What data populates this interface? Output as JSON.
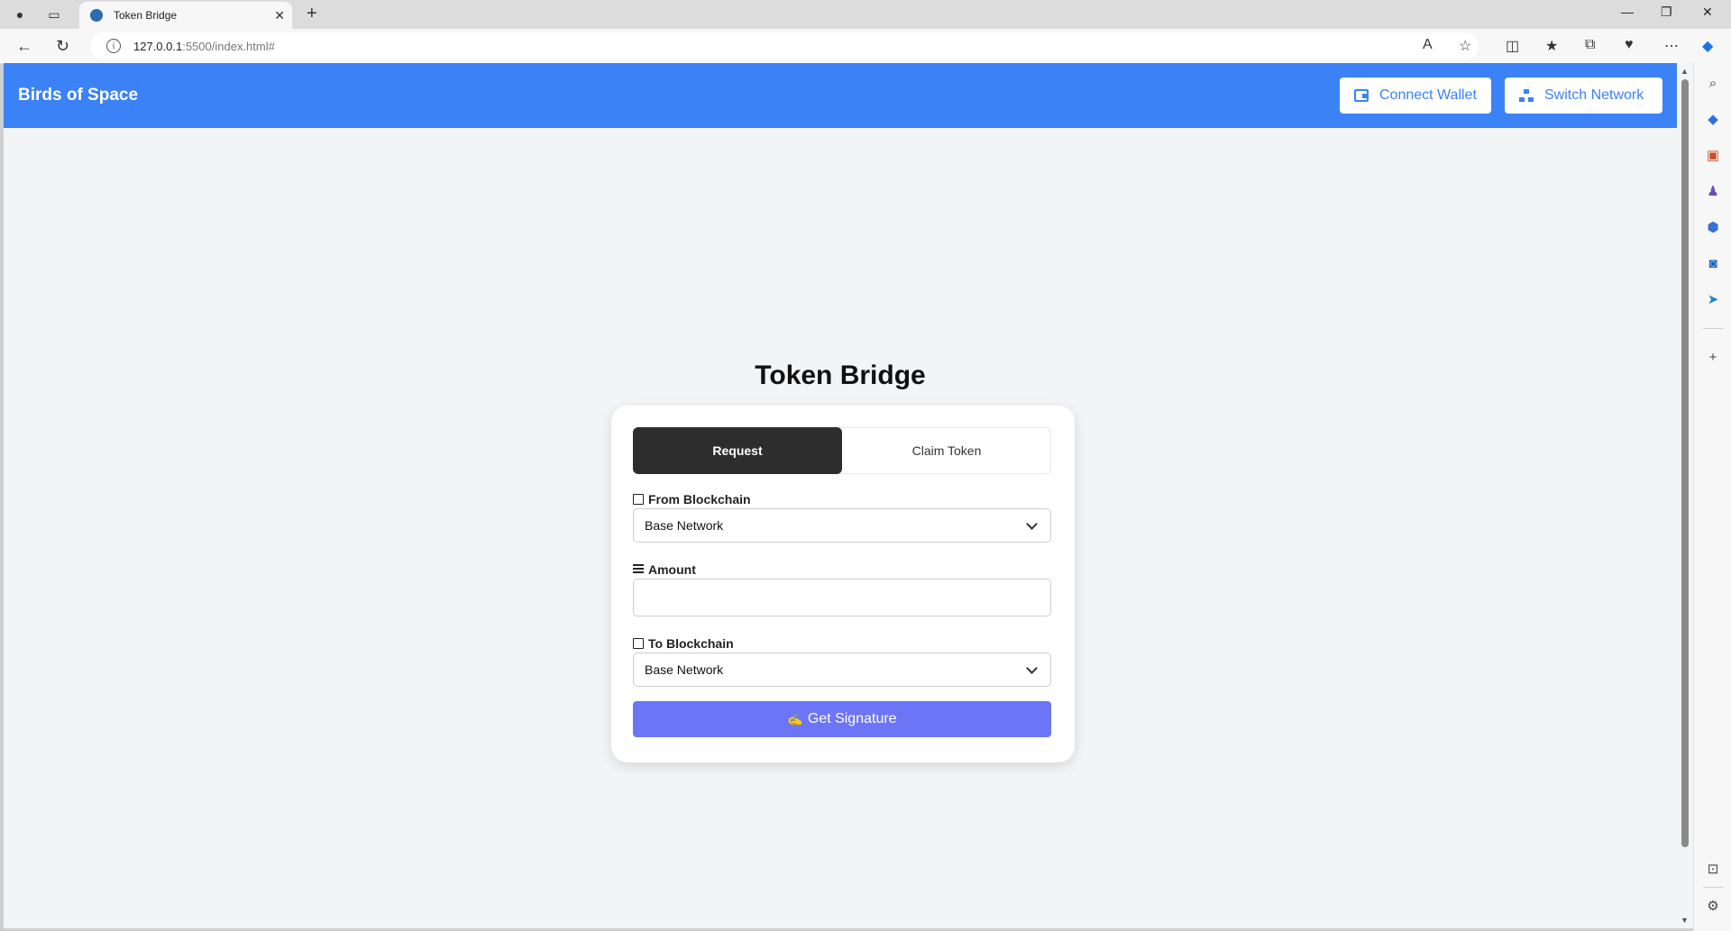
{
  "browser": {
    "tab_title": "Token Bridge",
    "url_host": "127.0.0.1",
    "url_rest": ":5500/index.html#"
  },
  "header": {
    "brand": "Birds of Space",
    "connect_wallet": "Connect Wallet",
    "switch_network": "Switch Network",
    "color": "#3b82f6"
  },
  "main": {
    "title": "Token Bridge",
    "tabs": [
      {
        "label": "Request",
        "active": true
      },
      {
        "label": "Claim Token",
        "active": false
      }
    ],
    "from_label": "From Blockchain",
    "from_value": "Base Network",
    "amount_label": "Amount",
    "amount_value": "",
    "to_label": "To Blockchain",
    "to_value": "Base Network",
    "submit_label": "Get Signature",
    "submit_color": "#6c75f5"
  }
}
